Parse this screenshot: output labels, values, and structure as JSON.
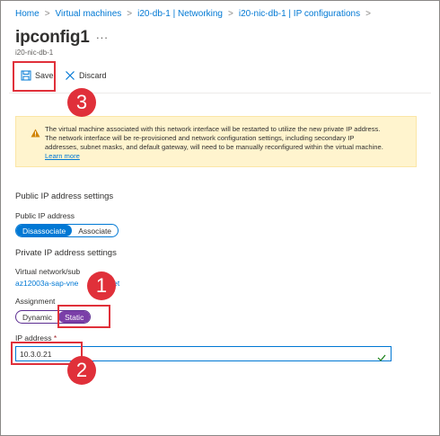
{
  "breadcrumb": {
    "items": [
      "Home",
      "Virtual machines",
      "i20-db-1 | Networking",
      "i20-nic-db-1 | IP configurations"
    ],
    "separator": ">"
  },
  "header": {
    "title": "ipconfig1",
    "subtitle": "i20-nic-db-1",
    "more_label": "..."
  },
  "toolbar": {
    "save_label": "Save",
    "discard_label": "Discard"
  },
  "warning": {
    "text": "The virtual machine associated with this network interface will be restarted to utilize the new private IP address. The network interface will be re-provisioned and network configuration settings, including secondary IP addresses, subnet masks, and default gateway, will need to be manually reconfigured within the virtual machine.",
    "link": "Learn more"
  },
  "public_ip": {
    "section_title": "Public IP address settings",
    "field_label": "Public IP address",
    "options": [
      "Disassociate",
      "Associate"
    ],
    "selected": "Disassociate"
  },
  "private_ip": {
    "section_title": "Private IP address settings",
    "vnet_label": "Virtual network/sub",
    "vnet_value": "az12003a-sap-vne",
    "vnet_value_tail": "net",
    "assignment_label": "Assignment",
    "assignment_options": [
      "Dynamic",
      "Static"
    ],
    "assignment_selected": "Static",
    "ip_label": "IP address",
    "ip_required_mark": "*",
    "ip_value": "10.3.0.21"
  },
  "callouts": [
    "1",
    "2",
    "3"
  ],
  "colors": {
    "accent": "#0078d4",
    "highlight_red": "#e0303a",
    "static_purple": "#7b3fa8",
    "warning_bg": "#fff4ce"
  }
}
